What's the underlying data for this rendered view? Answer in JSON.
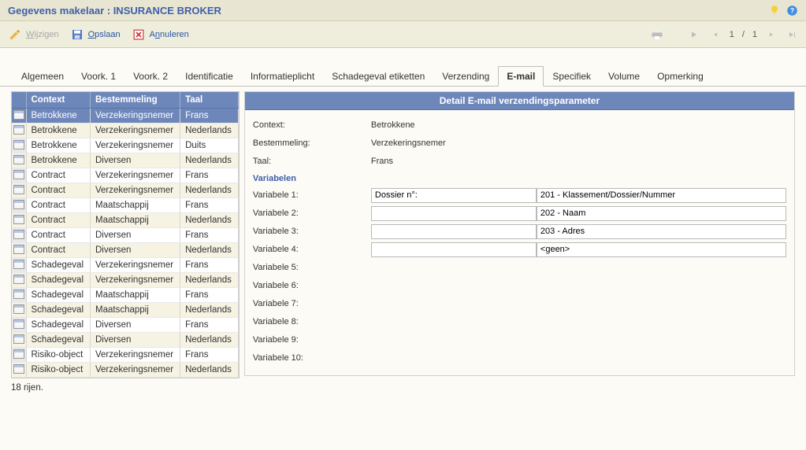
{
  "title": "Gegevens makelaar : INSURANCE BROKER",
  "toolbar": {
    "wijzigen": "Wijzigen",
    "opslaan": "Opslaan",
    "annuleren": "Annuleren",
    "page_current": "1",
    "page_sep": "/",
    "page_total": "1"
  },
  "tabs": [
    {
      "label": "Algemeen"
    },
    {
      "label": "Voork. 1"
    },
    {
      "label": "Voork. 2"
    },
    {
      "label": "Identificatie"
    },
    {
      "label": "Informatieplicht"
    },
    {
      "label": "Schadegeval etiketten"
    },
    {
      "label": "Verzending"
    },
    {
      "label": "E-mail",
      "active": true
    },
    {
      "label": "Specifiek"
    },
    {
      "label": "Volume"
    },
    {
      "label": "Opmerking"
    }
  ],
  "grid": {
    "columns": [
      "Context",
      "Bestemmeling",
      "Taal"
    ],
    "rows": [
      {
        "sel": true,
        "c": [
          "Betrokkene",
          "Verzekeringsnemer",
          "Frans"
        ]
      },
      {
        "c": [
          "Betrokkene",
          "Verzekeringsnemer",
          "Nederlands"
        ]
      },
      {
        "c": [
          "Betrokkene",
          "Verzekeringsnemer",
          "Duits"
        ]
      },
      {
        "c": [
          "Betrokkene",
          "Diversen",
          "Nederlands"
        ]
      },
      {
        "c": [
          "Contract",
          "Verzekeringsnemer",
          "Frans"
        ]
      },
      {
        "c": [
          "Contract",
          "Verzekeringsnemer",
          "Nederlands"
        ]
      },
      {
        "c": [
          "Contract",
          "Maatschappij",
          "Frans"
        ]
      },
      {
        "c": [
          "Contract",
          "Maatschappij",
          "Nederlands"
        ]
      },
      {
        "c": [
          "Contract",
          "Diversen",
          "Frans"
        ]
      },
      {
        "c": [
          "Contract",
          "Diversen",
          "Nederlands"
        ]
      },
      {
        "c": [
          "Schadegeval",
          "Verzekeringsnemer",
          "Frans"
        ]
      },
      {
        "c": [
          "Schadegeval",
          "Verzekeringsnemer",
          "Nederlands"
        ]
      },
      {
        "c": [
          "Schadegeval",
          "Maatschappij",
          "Frans"
        ]
      },
      {
        "c": [
          "Schadegeval",
          "Maatschappij",
          "Nederlands"
        ]
      },
      {
        "c": [
          "Schadegeval",
          "Diversen",
          "Frans"
        ]
      },
      {
        "c": [
          "Schadegeval",
          "Diversen",
          "Nederlands"
        ]
      },
      {
        "c": [
          "Risiko-object",
          "Verzekeringsnemer",
          "Frans"
        ]
      },
      {
        "c": [
          "Risiko-object",
          "Verzekeringsnemer",
          "Nederlands"
        ]
      }
    ]
  },
  "detail": {
    "title": "Detail E-mail verzendingsparameter",
    "context_label": "Context:",
    "context_value": "Betrokkene",
    "bestemmeling_label": "Bestemmeling:",
    "bestemmeling_value": "Verzekeringsnemer",
    "taal_label": "Taal:",
    "taal_value": "Frans",
    "variabelen_label": "Variabelen",
    "vars": [
      {
        "label": "Variabele 1:",
        "v1": "Dossier n°:",
        "v2": "201 - Klassement/Dossier/Nummer"
      },
      {
        "label": "Variabele 2:",
        "v1": "",
        "v2": "202 - Naam"
      },
      {
        "label": "Variabele 3:",
        "v1": "",
        "v2": "203 - Adres"
      },
      {
        "label": "Variabele 4:",
        "v1": "",
        "v2": "<geen>"
      },
      {
        "label": "Variabele 5:",
        "v1": "",
        "v2": ""
      },
      {
        "label": "Variabele 6:",
        "v1": "",
        "v2": ""
      },
      {
        "label": "Variabele 7:",
        "v1": "",
        "v2": ""
      },
      {
        "label": "Variabele 8:",
        "v1": "",
        "v2": ""
      },
      {
        "label": "Variabele 9:",
        "v1": "",
        "v2": ""
      },
      {
        "label": "Variabele 10:",
        "v1": "",
        "v2": ""
      }
    ]
  },
  "footer": "18 rijen."
}
